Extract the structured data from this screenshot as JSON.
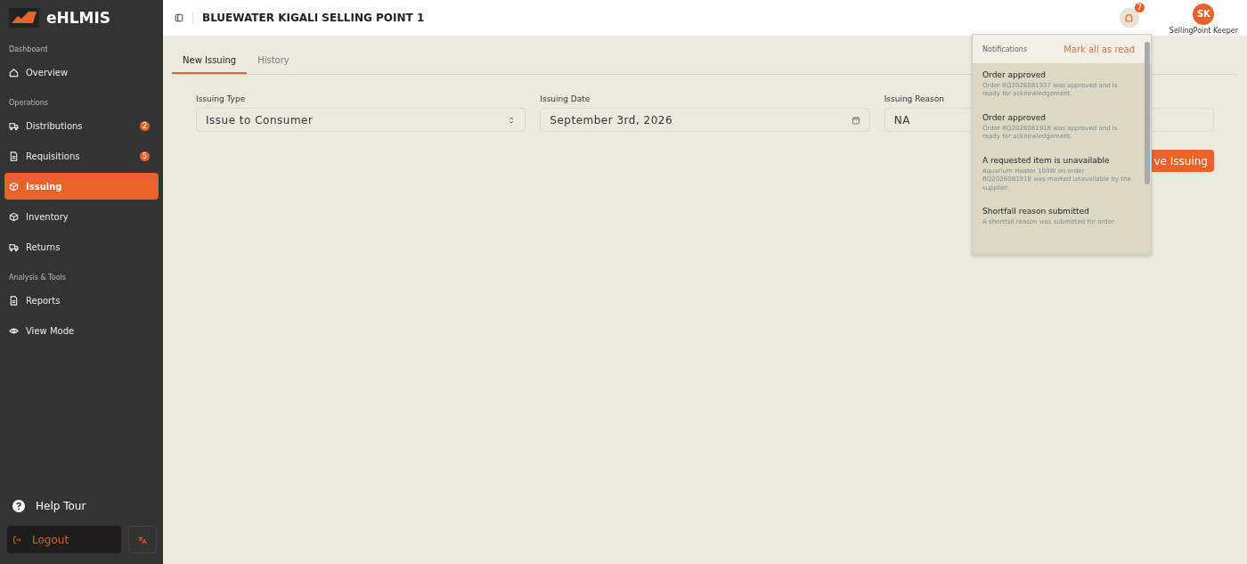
{
  "app": {
    "name": "eHLMIS"
  },
  "sidebar": {
    "sections": [
      {
        "title": "Dashboard",
        "items": [
          {
            "label": "Overview",
            "selected": false
          }
        ]
      },
      {
        "title": "Operations",
        "items": [
          {
            "label": "Distributions",
            "badge": "2",
            "selected": false
          },
          {
            "label": "Requisitions",
            "badge": "5",
            "selected": false
          },
          {
            "label": "Issuing",
            "selected": true
          },
          {
            "label": "Inventory",
            "selected": false
          },
          {
            "label": "Returns",
            "selected": false
          }
        ]
      },
      {
        "title": "Analysis & Tools",
        "items": [
          {
            "label": "Reports",
            "selected": false
          },
          {
            "label": "View Mode",
            "selected": false
          }
        ]
      }
    ],
    "help": "Help Tour",
    "logout": "Logout"
  },
  "header": {
    "title": "BLUEWATER KIGALI SELLING POINT 1",
    "notification_count": "7",
    "user_initials": "SK",
    "user_name": "SellingPoint Keeper"
  },
  "tabs": [
    {
      "label": "New Issuing",
      "selected": true
    },
    {
      "label": "History",
      "selected": false
    }
  ],
  "form": {
    "fields": [
      {
        "label": "Issuing Type",
        "value": "Issue to Consumer",
        "kind": "select"
      },
      {
        "label": "Issuing Date",
        "value": "September 3rd, 2026",
        "kind": "date"
      },
      {
        "label": "Issuing Reason",
        "value": "NA",
        "kind": "text"
      }
    ],
    "button": "ve Issuing"
  },
  "notifications": {
    "title": "Notifications",
    "mark_all": "Mark all as read",
    "items": [
      {
        "title": "Order approved",
        "body": "Order RQ2026081937 was approved and is ready for acknowledgement."
      },
      {
        "title": "Order approved",
        "body": "Order RQ2026081918 was approved and is ready for acknowledgement."
      },
      {
        "title": "A requested item is unavailable",
        "body": "Aquarium Heater 100W on order RQ2026081918 was marked unavailable by the supplier."
      },
      {
        "title": "Shortfall reason submitted",
        "body": "A shortfall reason was submitted for order"
      }
    ]
  }
}
